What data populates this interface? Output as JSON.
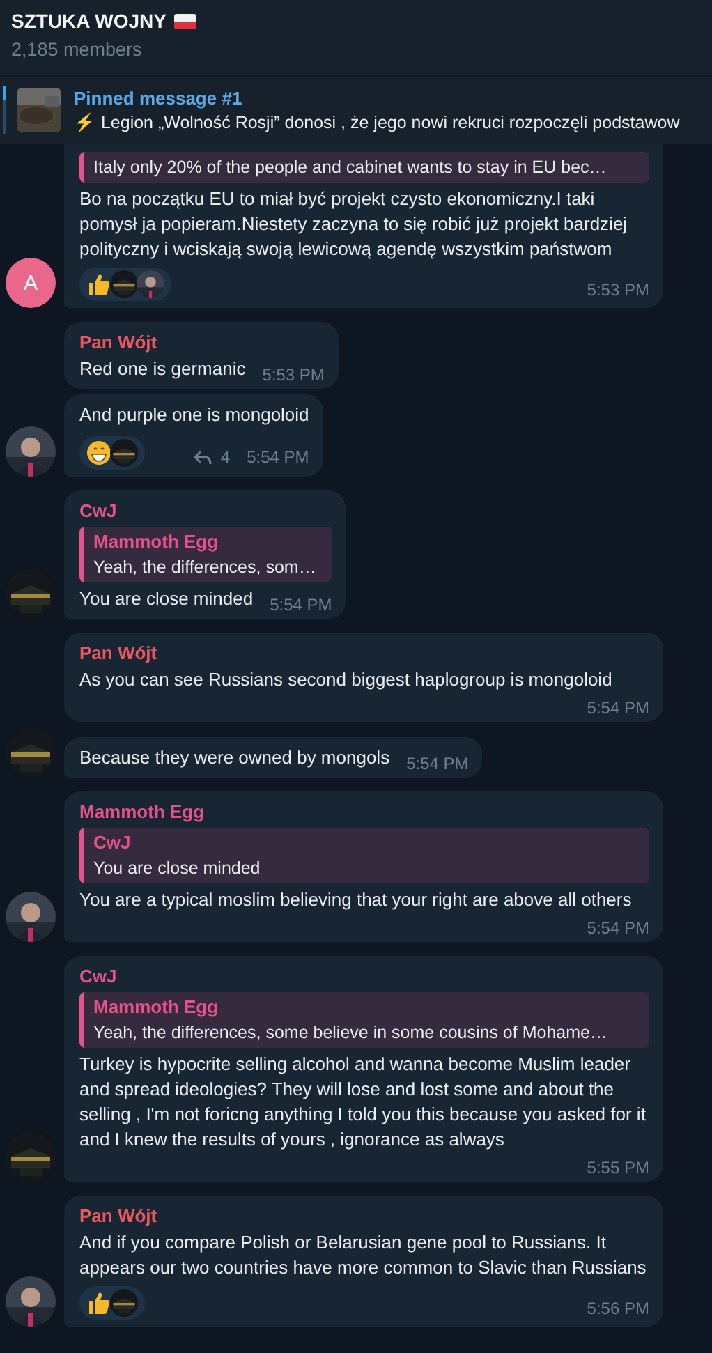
{
  "header": {
    "title": "SZTUKA WOJNY",
    "members": "2,185 members"
  },
  "pinned": {
    "label": "Pinned message #1",
    "text": "⚡ Legion „Wolność Rosji” donosi , że jego nowi rekruci rozpoczęli podstawow"
  },
  "messages": [
    {
      "quote": {
        "color": "#e5528a",
        "text": "Italy only 20% of the people and cabinet wants to stay in EU bec…"
      },
      "text": "Bo na początku EU to miał być projekt czysto ekonomiczny.I taki pomysł ja popieram.Niestety zaczyna to się robić już projekt bardziej polityczny i wciskają swoją lewicową agendę wszystkim państwom",
      "reactions": [
        {
          "kind": "thumbs_up",
          "reactors": [
            {
              "kind": "picture"
            },
            {
              "kind": "picture"
            }
          ]
        }
      ],
      "time": "5:53 PM",
      "avatar": {
        "kind": "letter",
        "letter": "A",
        "color": "#e8678a"
      }
    },
    {
      "sender": "Pan Wójt",
      "color": "#e8585e",
      "text": "Red one is germanic",
      "time": "5:53 PM"
    },
    {
      "text": "And purple one is mongoloid",
      "reactions": [
        {
          "kind": "grin",
          "reactors": [
            {
              "kind": "picture"
            }
          ]
        }
      ],
      "replies": "4",
      "time": "5:54 PM",
      "avatar": {
        "kind": "picture"
      }
    },
    {
      "sender": "CwJ",
      "color": "#e5528a",
      "quote": {
        "author": "Mammoth Egg",
        "color": "#e5528a",
        "text": "Yeah, the differences, som…"
      },
      "text": "You are close minded",
      "time": "5:54 PM",
      "avatar": {
        "kind": "picture"
      }
    },
    {
      "sender": "Pan Wójt",
      "color": "#e8585e",
      "text": "As you can see Russians second biggest haplogroup is mongoloid",
      "time": "5:54 PM"
    },
    {
      "text": "Because they were owned by mongols",
      "time": "5:54 PM",
      "avatar": {
        "kind": "picture"
      }
    },
    {
      "sender": "Mammoth Egg",
      "color": "#e5528a",
      "quote": {
        "author": "CwJ",
        "color": "#e5528a",
        "text": "You are close minded"
      },
      "text": "You are a typical moslim believing that your right are above all others",
      "time": "5:54 PM",
      "avatar": {
        "kind": "picture"
      }
    },
    {
      "sender": "CwJ",
      "color": "#e5528a",
      "quote": {
        "author": "Mammoth Egg",
        "color": "#e5528a",
        "text": "Yeah, the differences, some believe in some cousins of Mohame…"
      },
      "text": "Turkey is hypocrite selling alcohol and wanna become Muslim leader and spread ideologies? They will lose and lost some and about the selling , I'm not foricng anything I told you this because you asked for it and I knew the results of yours , ignorance as always",
      "time": "5:55 PM",
      "avatar": {
        "kind": "picture"
      }
    },
    {
      "sender": "Pan Wójt",
      "color": "#e8585e",
      "text": "And if you compare Polish or Belarusian gene pool to Russians. It appears our two countries have more common to Slavic than Russians",
      "reactions": [
        {
          "kind": "thumbs_up",
          "reactors": [
            {
              "kind": "picture"
            }
          ]
        }
      ],
      "time": "5:56 PM",
      "avatar": {
        "kind": "picture"
      }
    }
  ]
}
